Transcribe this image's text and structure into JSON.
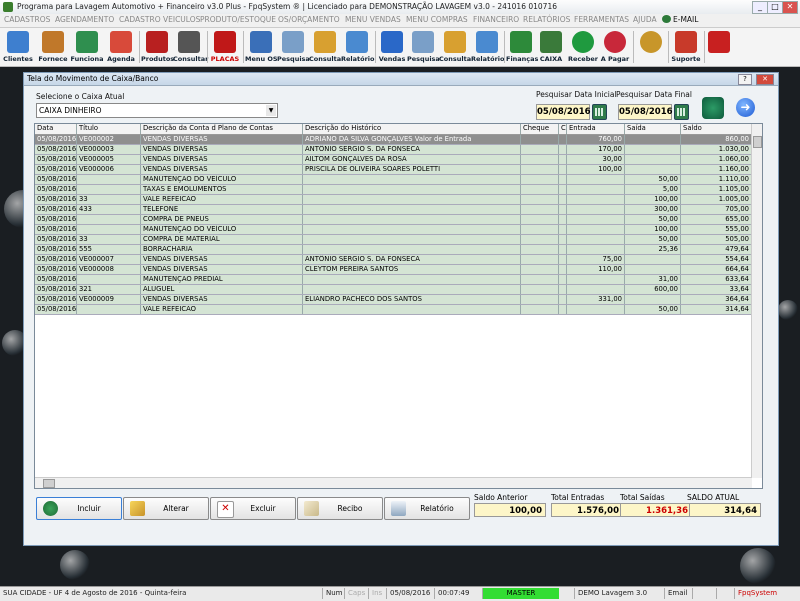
{
  "window": {
    "title": "Programa para Lavagem Automotivo + Financeiro v3.0 Plus - FpqSystem ® | Licenciado para  DEMONSTRAÇÃO LAVAGEM v3.0 - 241016 010716",
    "min": "_",
    "max": "□",
    "close": "✕"
  },
  "menu": [
    "CADASTROS",
    "AGENDAMENTO",
    "CADASTRO VEICULOS",
    "PRODUTO/ESTOQUE",
    "OS/ORÇAMENTO",
    "MENU VENDAS",
    "MENU COMPRAS",
    "FINANCEIRO",
    "RELATÓRIOS",
    "FERRAMENTAS",
    "AJUDA",
    "E-MAIL"
  ],
  "toolbar": [
    {
      "label": "Clientes",
      "icon": "clients-icon",
      "color": "#3e7fcf"
    },
    {
      "label": "Fornece",
      "icon": "supplier-icon",
      "color": "#c0782a"
    },
    {
      "label": "Funciona",
      "icon": "employee-icon",
      "color": "#2f8f4f"
    },
    {
      "label": "Agenda",
      "icon": "calendar-icon",
      "color": "#d84a3a"
    },
    {
      "label": "Produtos",
      "icon": "products-icon",
      "color": "#b82020"
    },
    {
      "label": "Consultar",
      "icon": "barcode-icon",
      "color": "#555555"
    },
    {
      "label": "PLACAS",
      "icon": "car-icon",
      "color": "#c01818"
    },
    {
      "label": "Menu OS",
      "icon": "os-icon",
      "color": "#3a6fb8"
    },
    {
      "label": "Pesquisa",
      "icon": "search-doc-icon",
      "color": "#7a9fc8"
    },
    {
      "label": "Consulta",
      "icon": "folder-icon",
      "color": "#d8a030"
    },
    {
      "label": "Relatório",
      "icon": "report-icon",
      "color": "#4a8ad0"
    },
    {
      "label": "Vendas",
      "icon": "monitor-icon",
      "color": "#2a68c8"
    },
    {
      "label": "Pesquisa",
      "icon": "search-doc-icon",
      "color": "#7a9fc8"
    },
    {
      "label": "Consulta",
      "icon": "folder-icon",
      "color": "#d8a030"
    },
    {
      "label": "Relatório",
      "icon": "report-icon",
      "color": "#4a8ad0"
    },
    {
      "label": "Finanças",
      "icon": "money-bag-icon",
      "color": "#2d8a3a"
    },
    {
      "label": "CAIXA",
      "icon": "cash-register-icon",
      "color": "#3a7a3a"
    },
    {
      "label": "Receber",
      "icon": "dollar-green-icon",
      "color": "#1f9a3f"
    },
    {
      "label": "A Pagar",
      "icon": "dollar-red-icon",
      "color": "#c8283a"
    },
    {
      "label": "",
      "icon": "coins-icon",
      "color": "#c8962a"
    },
    {
      "label": "Suporte",
      "icon": "support-icon",
      "color": "#c83a2a"
    },
    {
      "label": "",
      "icon": "exit-icon",
      "color": "#c82020"
    }
  ],
  "dialog": {
    "title": "Tela do Movimento de Caixa/Banco",
    "help": "?",
    "close": "✕",
    "caixa_label": "Selecione o Caixa Atual",
    "caixa_value": "CAIXA DINHEIRO",
    "data_inicial_label": "Pesquisar Data Inicial",
    "data_inicial": "05/08/2016",
    "data_final_label": "Pesquisar Data Final",
    "data_final": "05/08/2016"
  },
  "grid": {
    "columns": [
      "Data",
      "Título",
      "Descrição da Conta d Plano de Contas",
      "Descrição do Histórico",
      "Cheque",
      "C",
      "Entrada",
      "Saída",
      "Saldo"
    ],
    "rows": [
      [
        "05/08/2016",
        "VE000002",
        "VENDAS DIVERSAS",
        "ADRIANO  DA SILVA GONÇALVES Valor de Entrada",
        "",
        "",
        "760,00",
        "",
        "860,00"
      ],
      [
        "05/08/2016",
        "VE000003",
        "VENDAS DIVERSAS",
        "ANTÔNIO SERGIO S. DA FONSECA",
        "",
        "",
        "170,00",
        "",
        "1.030,00"
      ],
      [
        "05/08/2016",
        "VE000005",
        "VENDAS DIVERSAS",
        "AILTOM GONÇALVES DA ROSA",
        "",
        "",
        "30,00",
        "",
        "1.060,00"
      ],
      [
        "05/08/2016",
        "VE000006",
        "VENDAS DIVERSAS",
        "PRISCILA  DE OLIVEIRA SOARES POLETTI",
        "",
        "",
        "100,00",
        "",
        "1.160,00"
      ],
      [
        "05/08/2016",
        "",
        "MANUTENÇÃO DO VEÍCULO",
        "",
        "",
        "",
        "",
        "50,00",
        "1.110,00"
      ],
      [
        "05/08/2016",
        "",
        "TAXAS E EMOLUMENTOS",
        "",
        "",
        "",
        "",
        "5,00",
        "1.105,00"
      ],
      [
        "05/08/2016",
        "33",
        "VALE REFEICAO",
        "",
        "",
        "",
        "",
        "100,00",
        "1.005,00"
      ],
      [
        "05/08/2016",
        "433",
        "TELEFONE",
        "",
        "",
        "",
        "",
        "300,00",
        "705,00"
      ],
      [
        "05/08/2016",
        "",
        "COMPRA DE PNEUS",
        "",
        "",
        "",
        "",
        "50,00",
        "655,00"
      ],
      [
        "05/08/2016",
        "",
        "MANUTENÇÃO DO VEÍCULO",
        "",
        "",
        "",
        "",
        "100,00",
        "555,00"
      ],
      [
        "05/08/2016",
        "33",
        "COMPRA DE MATERIAL",
        "",
        "",
        "",
        "",
        "50,00",
        "505,00"
      ],
      [
        "05/08/2016",
        "555",
        "BORRACHARIA",
        "",
        "",
        "",
        "",
        "25,36",
        "479,64"
      ],
      [
        "05/08/2016",
        "VE000007",
        "VENDAS DIVERSAS",
        "ANTÔNIO SERGIO S. DA FONSECA",
        "",
        "",
        "75,00",
        "",
        "554,64"
      ],
      [
        "05/08/2016",
        "VE000008",
        "VENDAS DIVERSAS",
        "CLEYTOM PEREIRA SANTOS",
        "",
        "",
        "110,00",
        "",
        "664,64"
      ],
      [
        "05/08/2016",
        "",
        "MANUTENÇÃO PREDIAL",
        "",
        "",
        "",
        "",
        "31,00",
        "633,64"
      ],
      [
        "05/08/2016",
        "321",
        "ALUGUEL",
        "",
        "",
        "",
        "",
        "600,00",
        "33,64"
      ],
      [
        "05/08/2016",
        "VE000009",
        "VENDAS DIVERSAS",
        "ELIANDRO PACHECO DOS SANTOS",
        "",
        "",
        "331,00",
        "",
        "364,64"
      ],
      [
        "05/08/2016",
        "",
        "VALE REFEICAO",
        "",
        "",
        "",
        "",
        "50,00",
        "314,64"
      ]
    ]
  },
  "buttons": {
    "incluir": "Incluir",
    "alterar": "Alterar",
    "excluir": "Excluir",
    "recibo": "Recibo",
    "relatorio": "Relatório"
  },
  "totals": {
    "saldo_anterior_label": "Saldo Anterior",
    "saldo_anterior": "100,00",
    "entradas_label": "Total Entradas",
    "entradas": "1.576,00",
    "saidas_label": "Total Saídas",
    "saidas": "1.361,36",
    "saldo_label": "SALDO ATUAL",
    "saldo": "314,64"
  },
  "status": {
    "city": "SUA CIDADE - UF  4 de Agosto de 2016 - Quinta-feira",
    "num": "Num",
    "caps": "Caps",
    "ins": "Ins",
    "date": "05/08/2016",
    "time": "00:07:49",
    "user": "MASTER",
    "version": "DEMO Lavagem 3.0",
    "email": "Email",
    "brand": "FpqSystem"
  },
  "colors": {
    "accent": "#3a7fd6",
    "row": "#d4e4d4",
    "selected_row": "#8f8f8f",
    "field": "#fdf6c8",
    "saidas": "#cc0000"
  }
}
